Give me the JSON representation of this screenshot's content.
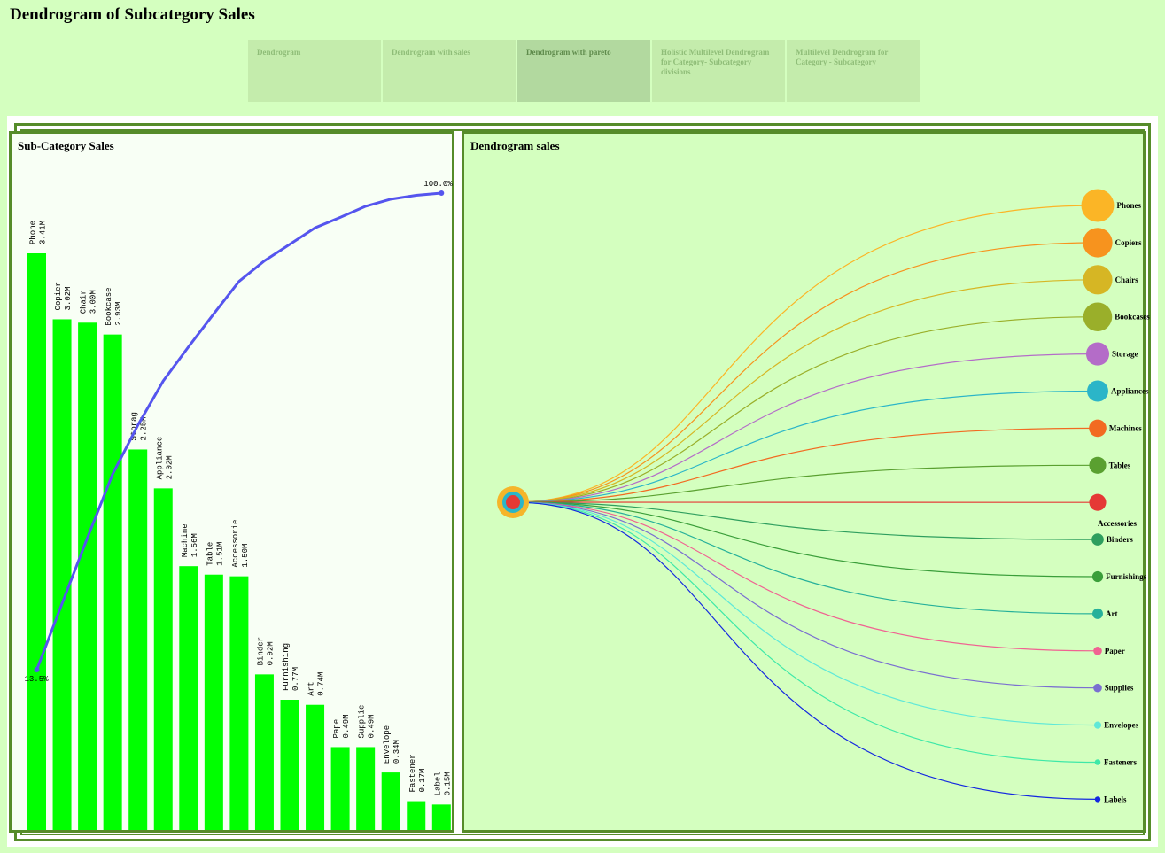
{
  "page": {
    "title": "Dendrogram of Subcategory Sales"
  },
  "tabs": [
    {
      "label": "Dendrogram",
      "active": false
    },
    {
      "label": "Dendrogram with sales",
      "active": false
    },
    {
      "label": "Dendrogram with pareto",
      "active": true
    },
    {
      "label": "Holistic Multilevel Dendrogram for Category- Subcategory divisions",
      "active": false
    },
    {
      "label": "Multilevel Dendrogram for Category - Subcategory",
      "active": false
    }
  ],
  "left_panel": {
    "title": "Sub-Category Sales"
  },
  "right_panel": {
    "title": "Dendrogram sales"
  },
  "chart_data": [
    {
      "type": "bar",
      "title": "Sub-Category Sales",
      "categories": [
        "Phone",
        "Copier",
        "Chair",
        "Bookcase",
        "Storag",
        "Appliance",
        "Machine",
        "Table",
        "Accessorie",
        "Binder",
        "Furnishing",
        "Art",
        "Pape",
        "Supplie",
        "Envelope",
        "Fastener",
        "Label"
      ],
      "value_labels": [
        "3.41M",
        "3.02M",
        "3.00M",
        "2.93M",
        "2.25M",
        "2.02M",
        "1.56M",
        "1.51M",
        "1.50M",
        "0.92M",
        "0.77M",
        "0.74M",
        "0.49M",
        "0.49M",
        "0.34M",
        "0.17M",
        "0.15M"
      ],
      "values": [
        3.41,
        3.02,
        3.0,
        2.93,
        2.25,
        2.02,
        1.56,
        1.51,
        1.5,
        0.92,
        0.77,
        0.74,
        0.49,
        0.49,
        0.34,
        0.17,
        0.15
      ],
      "bar_color": "#00ff00",
      "pareto": {
        "color": "#5555ee",
        "values": [
          13.5,
          25.5,
          37.4,
          49.0,
          57.9,
          65.9,
          72.1,
          78.1,
          84.0,
          87.7,
          90.7,
          93.7,
          95.6,
          97.6,
          98.9,
          99.6,
          100.0
        ],
        "first_label": "13.5%",
        "last_label": "100.0%"
      }
    },
    {
      "type": "dendrogram",
      "title": "Dendrogram sales",
      "root": {
        "colors": [
          "#f5b52a",
          "#2bb5c8",
          "#e53935"
        ]
      },
      "leaves": [
        {
          "label": "Phones",
          "value": 3.41,
          "color": "#fbb526"
        },
        {
          "label": "Copiers",
          "value": 3.02,
          "color": "#f7931e"
        },
        {
          "label": "Chairs",
          "value": 3.0,
          "color": "#d6b624"
        },
        {
          "label": "Bookcases",
          "value": 2.93,
          "color": "#9aaf2a"
        },
        {
          "label": "Storage",
          "value": 2.25,
          "color": "#b46cc8"
        },
        {
          "label": "Appliances",
          "value": 2.02,
          "color": "#2bb5c8"
        },
        {
          "label": "Machines",
          "value": 1.56,
          "color": "#f26a21"
        },
        {
          "label": "Tables",
          "value": 1.51,
          "color": "#5aa030"
        },
        {
          "label": "Accessories",
          "value": 1.5,
          "color": "#e53935"
        },
        {
          "label": "Binders",
          "value": 0.92,
          "color": "#2e9e5e"
        },
        {
          "label": "Furnishings",
          "value": 0.77,
          "color": "#3a9e3a"
        },
        {
          "label": "Art",
          "value": 0.74,
          "color": "#26b09a"
        },
        {
          "label": "Paper",
          "value": 0.49,
          "color": "#f06292"
        },
        {
          "label": "Supplies",
          "value": 0.49,
          "color": "#7a6fd0"
        },
        {
          "label": "Envelopes",
          "value": 0.34,
          "color": "#5fe8d8"
        },
        {
          "label": "Fasteners",
          "value": 0.17,
          "color": "#3ee8a8"
        },
        {
          "label": "Labels",
          "value": 0.15,
          "color": "#1428e0"
        }
      ]
    }
  ]
}
